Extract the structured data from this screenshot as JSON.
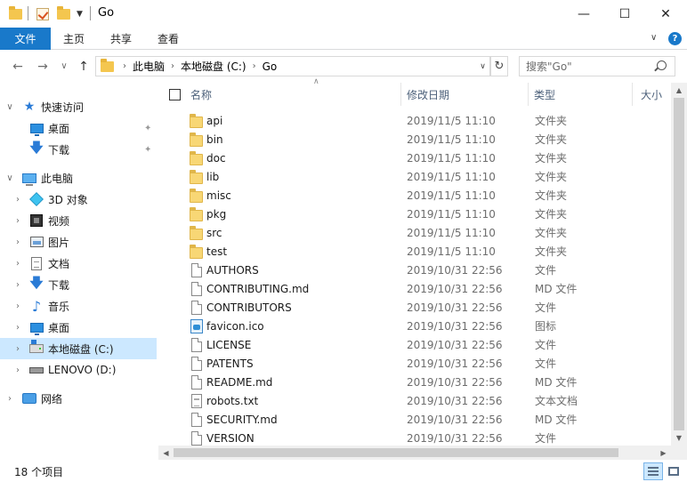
{
  "window": {
    "title": "Go",
    "minimize": "—",
    "maximize": "☐",
    "close": "✕"
  },
  "ribbon": {
    "file_tab": "文件",
    "tabs": [
      "主页",
      "共享",
      "查看"
    ],
    "collapse": "∨",
    "help": "?"
  },
  "nav_buttons": {
    "back": "←",
    "forward": "→",
    "recent": "∨",
    "up": "↑"
  },
  "address": {
    "crumbs": [
      "此电脑",
      "本地磁盘 (C:)",
      "Go"
    ],
    "separator": "›",
    "dropdown": "∨",
    "refresh": "↻"
  },
  "search": {
    "placeholder": "搜索\"Go\""
  },
  "navpane": {
    "quick_access": "快速访问",
    "quick_items": [
      {
        "label": "桌面",
        "icon": "desktop-icon"
      },
      {
        "label": "下载",
        "icon": "download-icon"
      }
    ],
    "this_pc": "此电脑",
    "pc_items": [
      {
        "label": "3D 对象",
        "icon": "3d-objects-icon"
      },
      {
        "label": "视频",
        "icon": "video-icon"
      },
      {
        "label": "图片",
        "icon": "pictures-icon"
      },
      {
        "label": "文档",
        "icon": "documents-icon"
      },
      {
        "label": "下载",
        "icon": "download-icon"
      },
      {
        "label": "音乐",
        "icon": "music-icon"
      },
      {
        "label": "桌面",
        "icon": "desktop-icon"
      },
      {
        "label": "本地磁盘 (C:)",
        "icon": "local-disk-icon"
      },
      {
        "label": "LENOVO (D:)",
        "icon": "usb-drive-icon"
      }
    ],
    "network": "网络",
    "selected": "本地磁盘 (C:)"
  },
  "columns": {
    "name": "名称",
    "date": "修改日期",
    "type": "类型",
    "size": "大小"
  },
  "files": [
    {
      "name": "api",
      "date": "2019/11/5 11:10",
      "type": "文件夹",
      "kind": "folder"
    },
    {
      "name": "bin",
      "date": "2019/11/5 11:10",
      "type": "文件夹",
      "kind": "folder"
    },
    {
      "name": "doc",
      "date": "2019/11/5 11:10",
      "type": "文件夹",
      "kind": "folder"
    },
    {
      "name": "lib",
      "date": "2019/11/5 11:10",
      "type": "文件夹",
      "kind": "folder"
    },
    {
      "name": "misc",
      "date": "2019/11/5 11:10",
      "type": "文件夹",
      "kind": "folder"
    },
    {
      "name": "pkg",
      "date": "2019/11/5 11:10",
      "type": "文件夹",
      "kind": "folder"
    },
    {
      "name": "src",
      "date": "2019/11/5 11:10",
      "type": "文件夹",
      "kind": "folder"
    },
    {
      "name": "test",
      "date": "2019/11/5 11:10",
      "type": "文件夹",
      "kind": "folder"
    },
    {
      "name": "AUTHORS",
      "date": "2019/10/31 22:56",
      "type": "文件",
      "kind": "file"
    },
    {
      "name": "CONTRIBUTING.md",
      "date": "2019/10/31 22:56",
      "type": "MD 文件",
      "kind": "file"
    },
    {
      "name": "CONTRIBUTORS",
      "date": "2019/10/31 22:56",
      "type": "文件",
      "kind": "file"
    },
    {
      "name": "favicon.ico",
      "date": "2019/10/31 22:56",
      "type": "图标",
      "kind": "image"
    },
    {
      "name": "LICENSE",
      "date": "2019/10/31 22:56",
      "type": "文件",
      "kind": "file"
    },
    {
      "name": "PATENTS",
      "date": "2019/10/31 22:56",
      "type": "文件",
      "kind": "file"
    },
    {
      "name": "README.md",
      "date": "2019/10/31 22:56",
      "type": "MD 文件",
      "kind": "file"
    },
    {
      "name": "robots.txt",
      "date": "2019/10/31 22:56",
      "type": "文本文档",
      "kind": "text"
    },
    {
      "name": "SECURITY.md",
      "date": "2019/10/31 22:56",
      "type": "MD 文件",
      "kind": "file"
    },
    {
      "name": "VERSION",
      "date": "2019/10/31 22:56",
      "type": "文件",
      "kind": "file"
    }
  ],
  "status": {
    "item_count": "18 个项目"
  },
  "colors": {
    "accent": "#1979ca",
    "selection": "#cce8ff",
    "folder": "#f8d775"
  }
}
